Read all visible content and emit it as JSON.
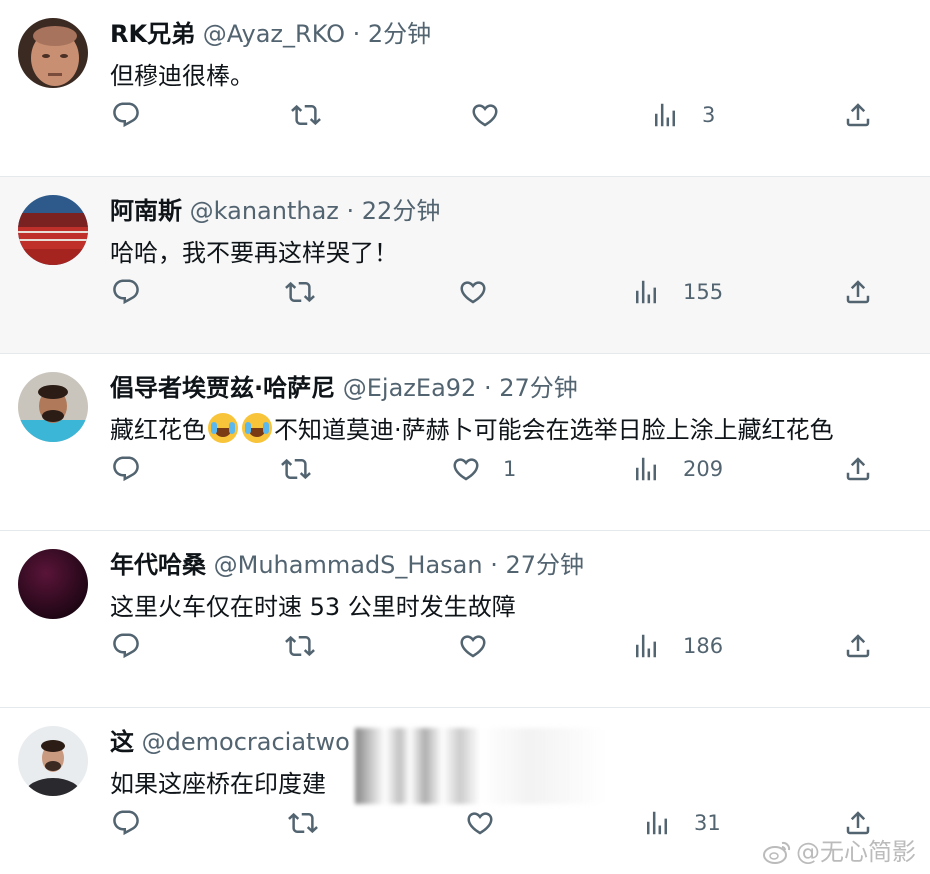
{
  "tweets": [
    {
      "name": "RK兄弟",
      "handle": "@Ayaz_RKO",
      "time": "2分钟",
      "text": "但穆迪很棒。",
      "likes": "",
      "views": "3"
    },
    {
      "name": "阿南斯",
      "handle": "@kananthaz",
      "time": "22分钟",
      "text": "哈哈，我不要再这样哭了！",
      "likes": "",
      "views": "155"
    },
    {
      "name": "倡导者埃贾兹·哈萨尼",
      "handle": "@EjazEa92",
      "time": "27分钟",
      "text_before": "藏红花色",
      "text_after": "不知道莫迪·萨赫卜可能会在选举日脸上涂上藏红花色",
      "likes": "1",
      "views": "209"
    },
    {
      "name": "年代哈桑",
      "handle": "@MuhammadS_Hasan",
      "time": "27分钟",
      "text": "这里火车仅在时速 53 公里时发生故障",
      "likes": "",
      "views": "186"
    },
    {
      "name": "这",
      "handle": "@democraciatwo",
      "time": "",
      "text": "如果这座桥在印度建",
      "likes": "",
      "views": "31"
    }
  ],
  "separator": " · ",
  "emoji": [
    "face-with-tears-of-joy",
    "face-with-tears-of-joy"
  ],
  "watermark": "@无心简影",
  "colors": {
    "text": "#0f1419",
    "secondary": "#536471",
    "alt_bg": "#f7f7f7"
  },
  "icons": {
    "reply": "reply-icon",
    "retweet": "retweet-icon",
    "like": "like-icon",
    "views": "views-icon",
    "share": "share-icon"
  }
}
